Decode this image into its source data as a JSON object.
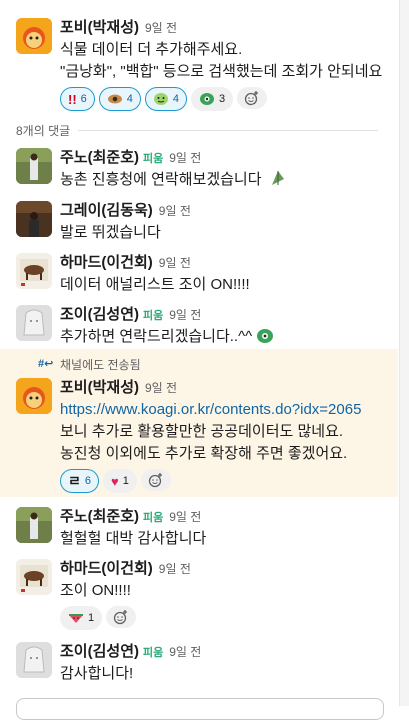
{
  "messages": {
    "parent": {
      "author": "포비(박재성)",
      "time": "9일 전",
      "lines": [
        "식물 데이터 더 추가해주세요.",
        "\"금낭화\", \"백합\" 등으로 검색했는데 조회가 안되네요"
      ],
      "reactions": [
        {
          "emoji": "‼️",
          "count": "6",
          "mine": true
        },
        {
          "emoji": "eye",
          "count": "4",
          "mine": true
        },
        {
          "emoji": "smile",
          "count": "4",
          "mine": true
        },
        {
          "emoji": "green-face",
          "count": "3",
          "mine": false
        }
      ]
    },
    "replies_label": "8개의 댓글",
    "replies": [
      {
        "author": "주노(최준호)",
        "tag": "피움",
        "time": "9일 전",
        "text": "농촌 진흥청에 연락해보겠습니다"
      },
      {
        "author": "그레이(김동욱)",
        "tag": "",
        "time": "9일 전",
        "text": "발로 뛰겠습니다"
      },
      {
        "author": "하마드(이건회)",
        "tag": "",
        "time": "9일 전",
        "text": "데이터 애널리스트 조이 ON!!!!"
      },
      {
        "author": "조이(김성연)",
        "tag": "피움",
        "time": "9일 전",
        "text": "추가하면 연락드리겠습니다..^^"
      },
      {
        "sent_label": "채널에도 전송됨",
        "author": "포비(박재성)",
        "tag": "",
        "time": "9일 전",
        "link": "https://www.koagi.or.kr/contents.do?idx=2065",
        "lines": [
          "보니 추가로 활용할만한 공공데이터도 많네요.",
          "농진청 이외에도 추가로 확장해 주면 좋겠어요."
        ],
        "reactions": [
          {
            "emoji": "ㄹ",
            "count": "6",
            "mine": true
          },
          {
            "emoji": "❤️",
            "count": "1",
            "mine": false
          }
        ]
      },
      {
        "author": "주노(최준호)",
        "tag": "피움",
        "time": "9일 전",
        "text": "헐헐헐 대박 감사합니다"
      },
      {
        "author": "하마드(이건회)",
        "tag": "",
        "time": "9일 전",
        "text": "조이 ON!!!!",
        "reactions": [
          {
            "emoji": "watermelon",
            "count": "1",
            "mine": false
          }
        ]
      },
      {
        "author": "조이(김성연)",
        "tag": "피움",
        "time": "9일 전",
        "text": "감사합니다!"
      }
    ]
  },
  "colors": {
    "link": "#1264a3",
    "highlight": "#fdf6e7",
    "tag": "#2bac76"
  }
}
